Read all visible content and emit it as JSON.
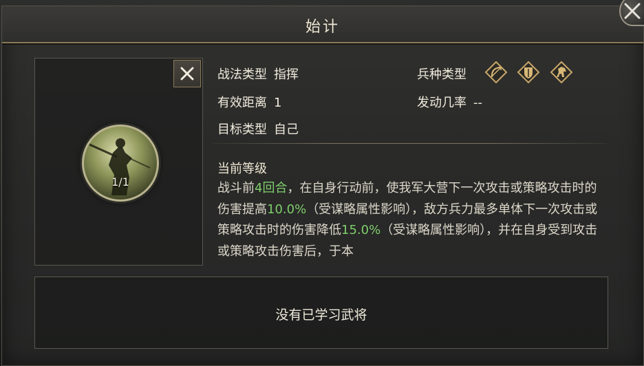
{
  "dialog": {
    "title": "始计"
  },
  "skill_card": {
    "level_text": "1/1"
  },
  "info": {
    "tactic_type_label": "战法类型",
    "tactic_type_value": "指挥",
    "range_label": "有效距离",
    "range_value": "1",
    "target_label": "目标类型",
    "target_value": "自己",
    "troop_type_label": "兵种类型",
    "trigger_rate_label": "发动几率",
    "trigger_rate_value": "--",
    "troop_icons": [
      "archer-icon",
      "shield-icon",
      "cavalry-icon"
    ]
  },
  "current_level": {
    "heading": "当前等级",
    "segments": [
      {
        "text": "战斗前",
        "highlight": false
      },
      {
        "text": "4回合",
        "highlight": true
      },
      {
        "text": "，在自身行动前，使我军大营下一次攻击或策略攻击时的伤害提高",
        "highlight": false
      },
      {
        "text": "10.0%",
        "highlight": true
      },
      {
        "text": "（受谋略属性影响），敌方兵力最多单体下一次攻击或策略攻击时的伤害降低",
        "highlight": false
      },
      {
        "text": "15.0%",
        "highlight": true
      },
      {
        "text": "（受谋略属性影响），并在自身受到攻击或策略攻击伤害后，于本",
        "highlight": false
      }
    ]
  },
  "generals": {
    "empty_text": "没有已学习武将"
  },
  "colors": {
    "highlight": "#7fce6c",
    "gold_border": "#8a7a55"
  }
}
